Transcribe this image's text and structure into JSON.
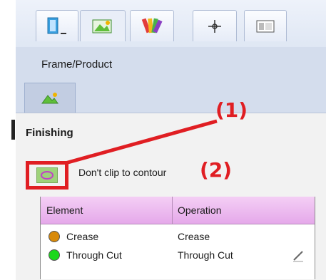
{
  "toolbar": {
    "buttons": [
      {
        "name": "frame-dropdown",
        "icon": "frame-dropdown-icon"
      },
      {
        "name": "product-image",
        "icon": "image-icon"
      },
      {
        "name": "palette",
        "icon": "palette-icon"
      },
      {
        "name": "crosshair",
        "icon": "crosshair-icon"
      },
      {
        "name": "layout",
        "icon": "layout-icon"
      }
    ]
  },
  "panel": {
    "title": "Frame/Product",
    "sub_tab_icon": "image-icon"
  },
  "finishing": {
    "title": "Finishing",
    "clip_label": "Don't clip to contour",
    "clip_icon": "contour-icon"
  },
  "annotations": {
    "one": "(1)",
    "two": "(2)"
  },
  "table": {
    "headers": [
      "Element",
      "Operation"
    ],
    "rows": [
      {
        "element": "Crease",
        "operation": "Crease",
        "color": "#d88a0a"
      },
      {
        "element": "Through Cut",
        "operation": "Through Cut",
        "color": "#1bd81b",
        "action_icon": "edit-icon"
      }
    ]
  },
  "colors": {
    "annotation_red": "#e01e23",
    "header_pink": "#e5a9ea",
    "panel_blue": "#d4dded"
  }
}
